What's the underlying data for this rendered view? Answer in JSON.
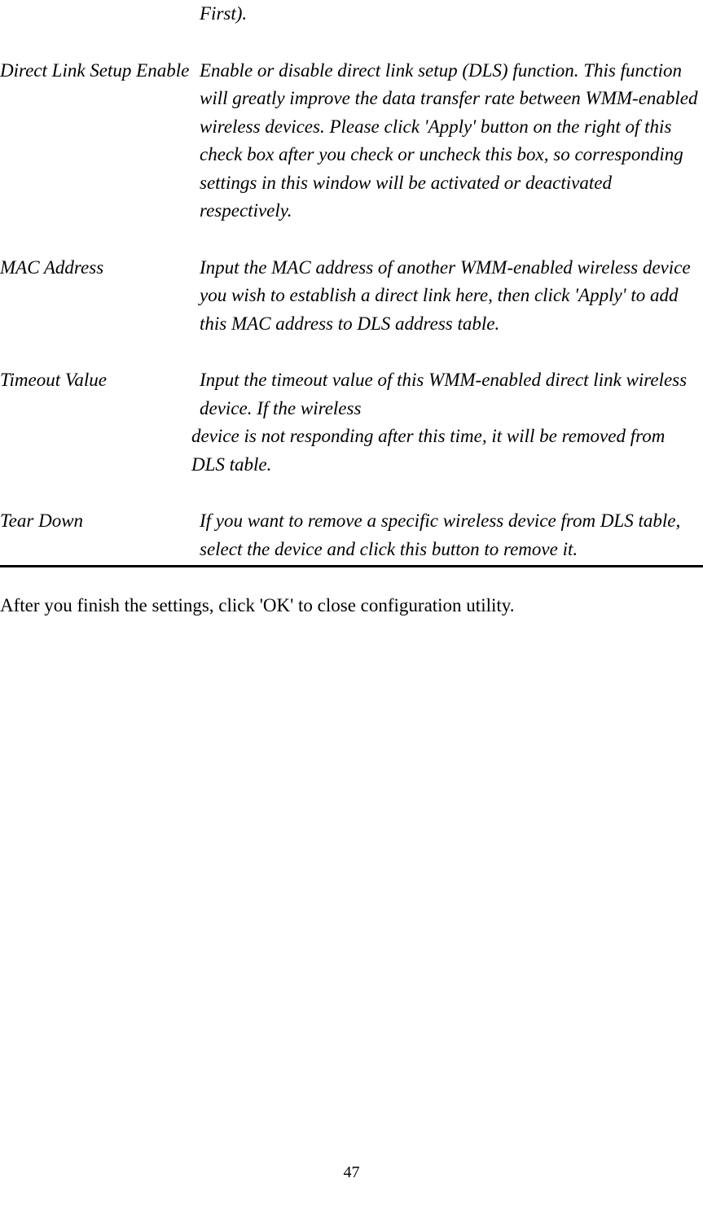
{
  "fragment_first": "First).",
  "entries": [
    {
      "term": "Direct Link Setup Enable",
      "desc": "Enable or disable direct link setup (DLS) function. This function will greatly improve the data transfer rate between WMM-enabled wireless devices. Please click 'Apply' button on the right of this check box after you check or uncheck this box, so corresponding settings in this window will be activated or deactivated respectively."
    },
    {
      "term": "MAC Address",
      "desc": "Input the MAC address of another WMM-enabled wireless device you wish to establish a direct link here, then click 'Apply' to add this MAC address to DLS address table."
    },
    {
      "term": "Timeout Value",
      "desc_part1": "Input the timeout value of this WMM-enabled direct link wireless device. If the wireless",
      "desc_part2": "device is not responding after this time, it will be removed from DLS table."
    },
    {
      "term": "Tear Down",
      "desc": "If you want to remove a specific wireless device from DLS table, select the device and click this button to remove it."
    }
  ],
  "after_text": "After you finish the settings, click 'OK' to close configuration utility.",
  "page_number": "47"
}
